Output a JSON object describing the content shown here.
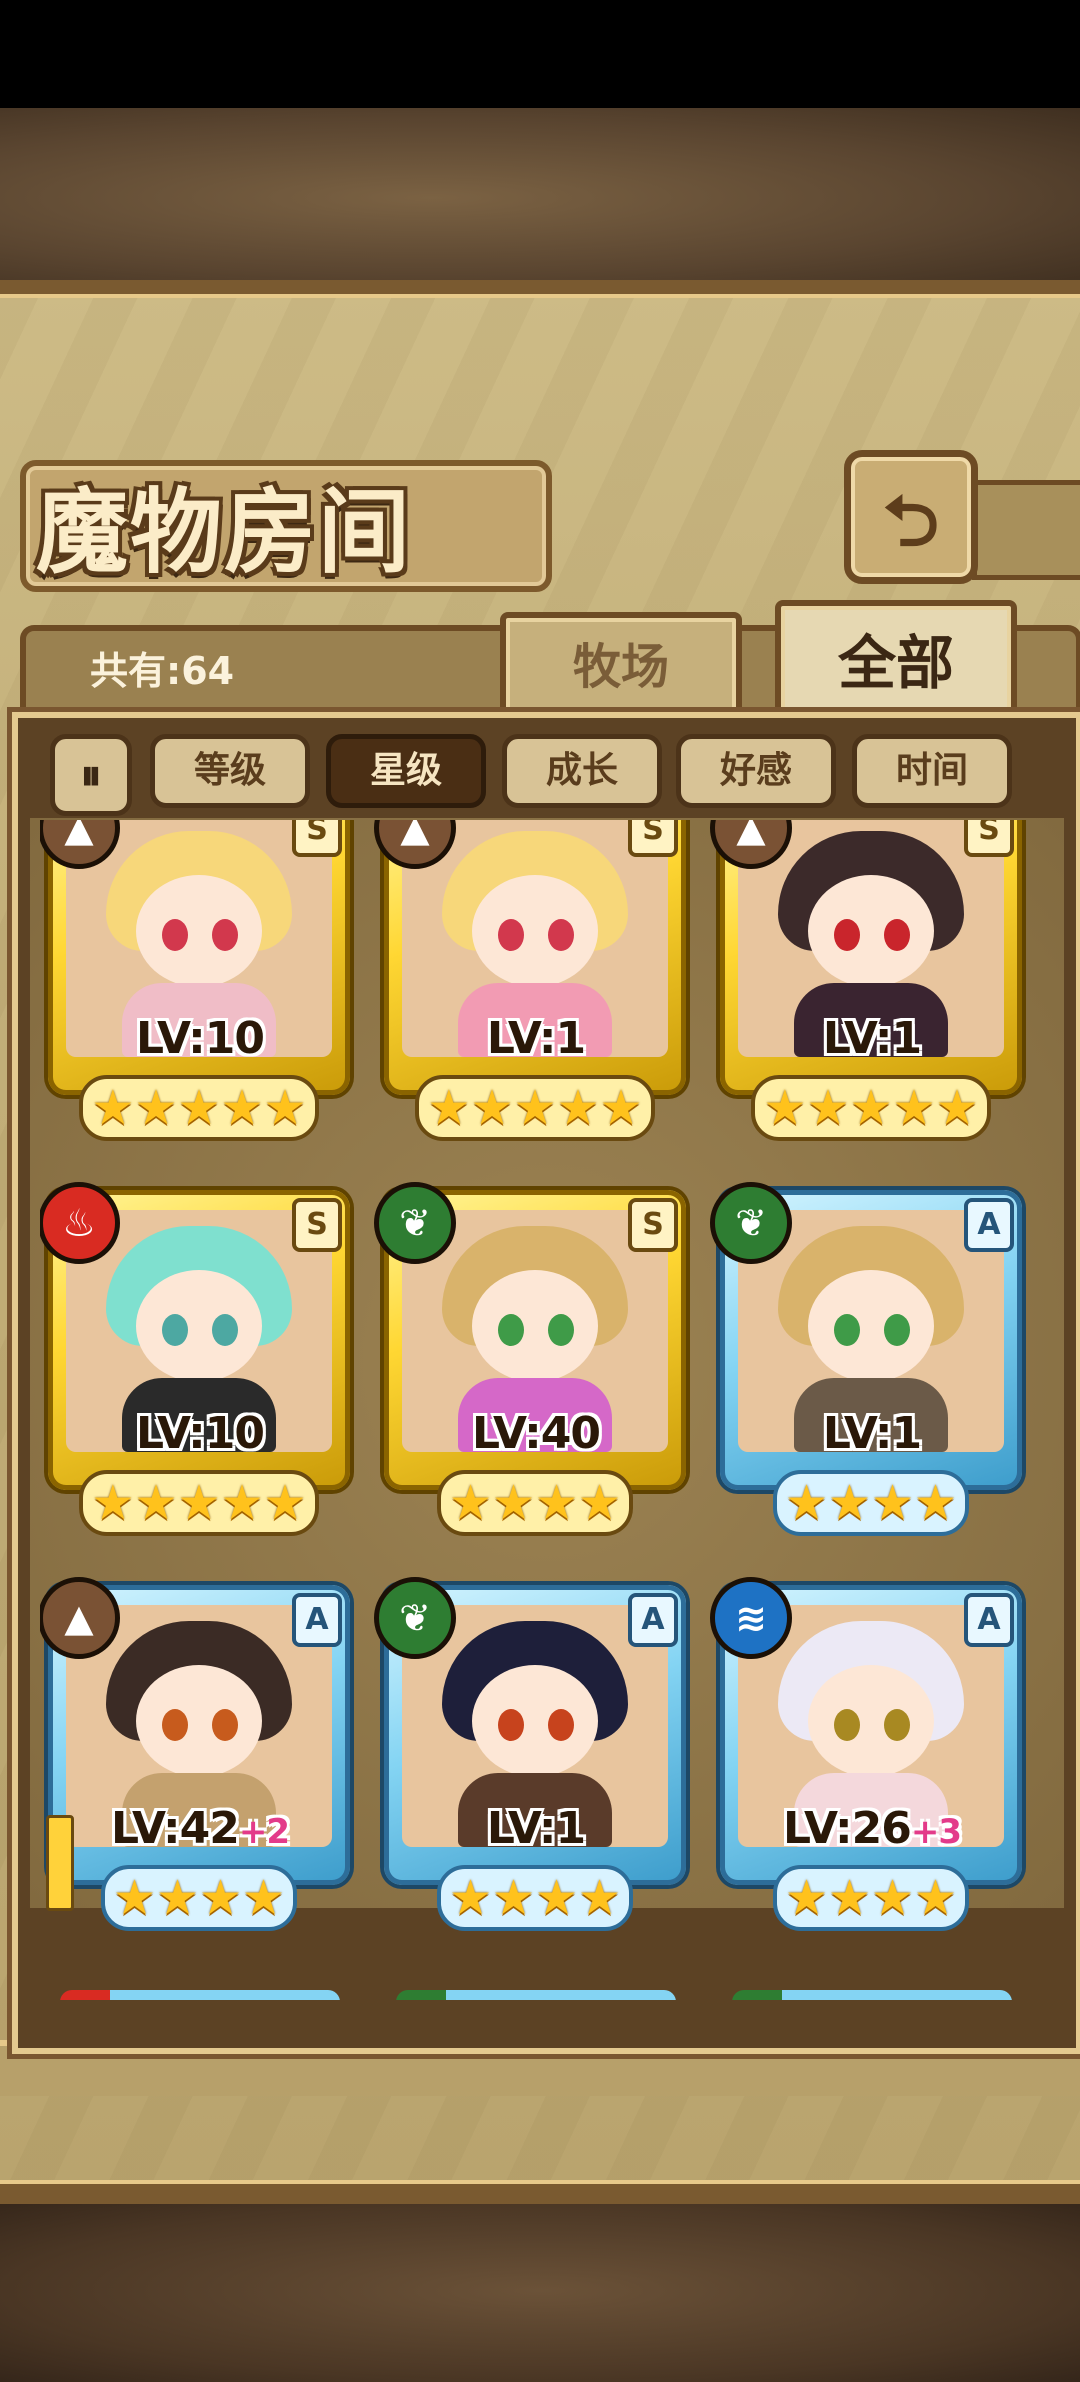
{
  "title": "魔物房间",
  "back_icon": "return-arrow-icon",
  "count_label": "共有:64",
  "tabs": [
    {
      "label": "牧场",
      "active": false
    },
    {
      "label": "全部",
      "active": true
    }
  ],
  "sort": {
    "toggle_glyph": "⏸",
    "buttons": [
      {
        "label": "等级",
        "active": false
      },
      {
        "label": "星级",
        "active": true
      },
      {
        "label": "成长",
        "active": false
      },
      {
        "label": "好感",
        "active": false
      },
      {
        "label": "时间",
        "active": false
      }
    ]
  },
  "monsters": [
    {
      "element": "earth",
      "rank": "S",
      "level": "LV:10",
      "plus": "",
      "stars": 5,
      "frame": "gold",
      "hair": "#f7d77a",
      "eyes": "#d2384d",
      "outfit": "#f0bdc7",
      "weapon": false
    },
    {
      "element": "earth",
      "rank": "S",
      "level": "LV:1",
      "plus": "",
      "stars": 5,
      "frame": "gold",
      "hair": "#f7d77a",
      "eyes": "#d2384d",
      "outfit": "#f29bb3",
      "weapon": false
    },
    {
      "element": "earth",
      "rank": "S",
      "level": "LV:1",
      "plus": "",
      "stars": 5,
      "frame": "gold",
      "hair": "#3c2a2a",
      "eyes": "#c9252c",
      "outfit": "#3a2430",
      "weapon": false
    },
    {
      "element": "fire",
      "rank": "S",
      "level": "LV:10",
      "plus": "",
      "stars": 5,
      "frame": "gold",
      "hair": "#7fe0cf",
      "eyes": "#4da8a2",
      "outfit": "#2a2a2a",
      "weapon": false
    },
    {
      "element": "plant",
      "rank": "S",
      "level": "LV:40",
      "plus": "",
      "stars": 4,
      "frame": "gold",
      "hair": "#d9b36b",
      "eyes": "#3f9b48",
      "outfit": "#d568c8",
      "weapon": false
    },
    {
      "element": "plant",
      "rank": "A",
      "level": "LV:1",
      "plus": "",
      "stars": 4,
      "frame": "blue",
      "hair": "#d9b36b",
      "eyes": "#3f9b48",
      "outfit": "#6b5a48",
      "weapon": false
    },
    {
      "element": "earth",
      "rank": "A",
      "level": "LV:42",
      "plus": "+2",
      "stars": 4,
      "frame": "blue",
      "hair": "#3b2b25",
      "eyes": "#c75b1d",
      "outfit": "#c4a16e",
      "weapon": true
    },
    {
      "element": "plant",
      "rank": "A",
      "level": "LV:1",
      "plus": "",
      "stars": 4,
      "frame": "blue",
      "hair": "#1e1f3a",
      "eyes": "#c7431d",
      "outfit": "#5a3b2a",
      "weapon": false
    },
    {
      "element": "water",
      "rank": "A",
      "level": "LV:26",
      "plus": "+3",
      "stars": 4,
      "frame": "blue",
      "hair": "#ece9f5",
      "eyes": "#a88922",
      "outfit": "#f4d8dc",
      "weapon": false
    }
  ],
  "element_icons": {
    "earth": "mountain-icon",
    "fire": "flame-icon",
    "plant": "leaf-icon",
    "water": "wave-icon"
  },
  "colors": {
    "gold_frame": "#ffd733",
    "blue_frame": "#84d4f3",
    "star": "#ffc21c",
    "bonus": "#e33b8a"
  }
}
